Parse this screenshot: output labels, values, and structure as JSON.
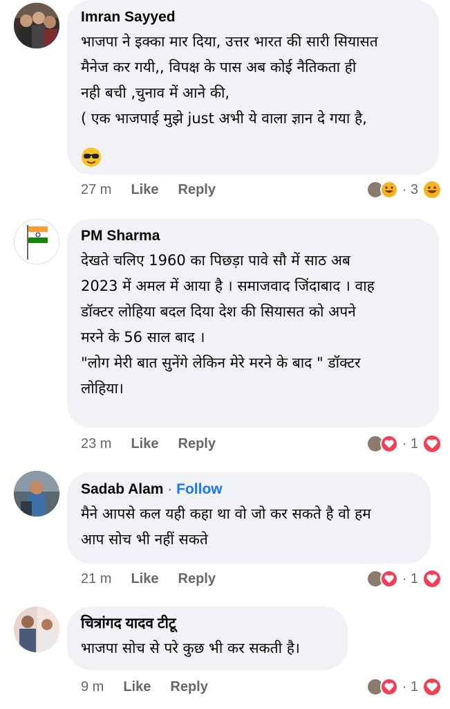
{
  "comments": [
    {
      "author": "Imran Sayyed",
      "text": "भाजपा ने इक्का मार दिया, उत्तर भारत की सारी सियासत\nमैनेज कर गयी,, विपक्ष के पास अब कोई नैतिकता ही\nनही बची ,चुनाव में आने की,\n( एक भाजपाई मुझे just अभी ये वाला ज्ञान दे गया है,",
      "time": "27 m",
      "like": "Like",
      "reply": "Reply",
      "reaction_count": "3",
      "reaction_icon": "haha-icon"
    },
    {
      "author": "PM Sharma",
      "text": "देखते चलिए 1960 का पिछड़ा पावे सौ में साठ अब\n2023 में अमल में आया है । समाजवाद जिंदाबाद । वाह\nडॉक्टर लोहिया बदल दिया देश की सियासत को अपने\nमरने के 56 साल बाद ।\n \"लोग मेरी बात सुनेंगे लेकिन मेरे मरने के बाद \" डॉक्टर\nलोहिया।",
      "time": "23 m",
      "like": "Like",
      "reply": "Reply",
      "reaction_count": "1",
      "reaction_icon": "heart-icon"
    },
    {
      "author": "Sadab Alam",
      "follow": "Follow",
      "separator": "·",
      "text": "मैने आपसे कल यही कहा था वो जो कर सकते है वो हम\nआप सोच भी नहीं सकते",
      "time": "21 m",
      "like": "Like",
      "reply": "Reply",
      "reaction_count": "1",
      "reaction_icon": "heart-icon"
    },
    {
      "author": "चित्रांगद यादव टीटू",
      "text": "भाजपा सोच से परे कुछ भी कर सकती है।",
      "time": "9 m",
      "like": "Like",
      "reply": "Reply",
      "reaction_count": "1",
      "reaction_icon": "heart-icon"
    }
  ],
  "colors": {
    "bubble": "#f0f2f5",
    "secondary_text": "#65676b",
    "follow_blue": "#1877f2",
    "heart": "#f33e58",
    "haha": "#f7b125"
  },
  "dot": "·"
}
